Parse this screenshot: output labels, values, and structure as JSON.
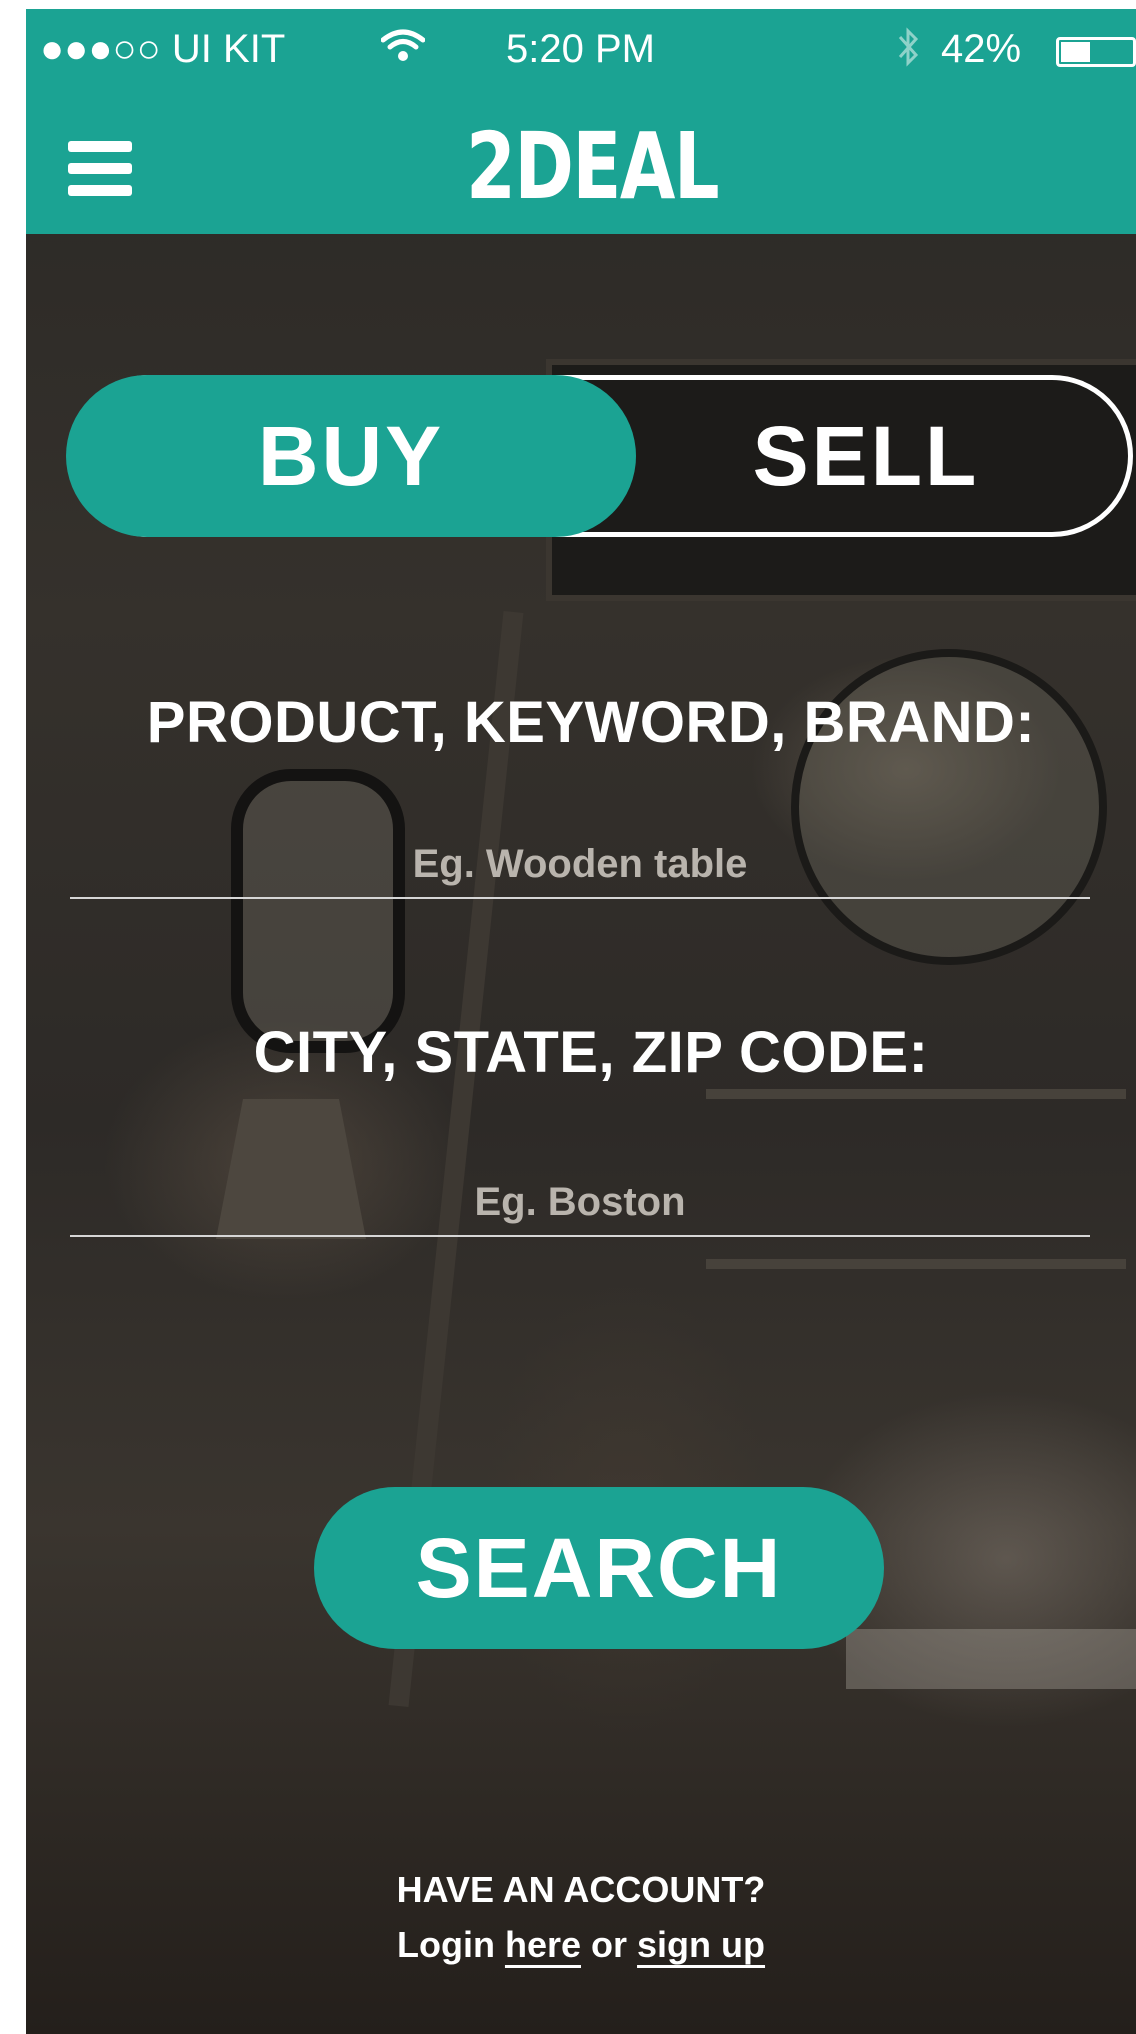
{
  "status_bar": {
    "carrier": "●●●○○ UI KIT",
    "wifi_icon": "wifi-icon",
    "time": "5:20 PM",
    "bluetooth_icon": "bluetooth-icon",
    "battery_percent": "42%",
    "battery_level": 0.42
  },
  "nav": {
    "menu_icon": "hamburger-menu-icon",
    "logo_text": "2DEAL"
  },
  "toggle": {
    "buy_label": "BUY",
    "sell_label": "SELL",
    "selected": "BUY"
  },
  "form": {
    "product_label": "PRODUCT, KEYWORD, BRAND:",
    "product_placeholder": "Eg. Wooden table",
    "location_label": "CITY, STATE, ZIP CODE:",
    "location_placeholder": "Eg. Boston",
    "search_label": "SEARCH"
  },
  "account": {
    "prompt": "HAVE AN ACCOUNT?",
    "login_prefix": "Login",
    "here_link": "here",
    "or_text": "or",
    "signup_link": "sign up"
  },
  "colors": {
    "accent": "#1ba393",
    "text": "#ffffff"
  }
}
